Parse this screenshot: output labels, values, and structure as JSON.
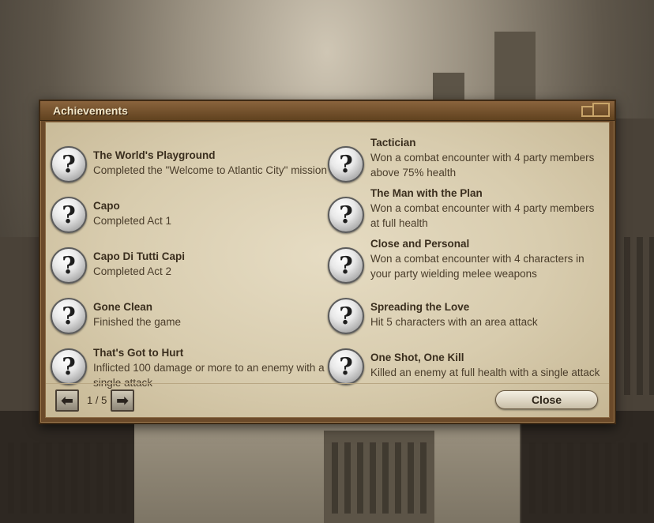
{
  "dialog": {
    "title": "Achievements",
    "achievements": [
      {
        "name": "The World's Playground",
        "desc": "Completed the \"Welcome to Atlantic City\" mission"
      },
      {
        "name": "Capo",
        "desc": "Completed Act 1"
      },
      {
        "name": "Capo Di Tutti Capi",
        "desc": "Completed Act 2"
      },
      {
        "name": "Gone Clean",
        "desc": "Finished the game"
      },
      {
        "name": "That's Got to Hurt",
        "desc": "Inflicted 100 damage or more to an enemy with a single attack"
      },
      {
        "name": "Tactician",
        "desc": "Won a combat encounter with 4 party members above 75% health"
      },
      {
        "name": "The Man with the Plan",
        "desc": "Won a combat encounter with 4 party members at full health"
      },
      {
        "name": "Close and Personal",
        "desc": "Won a combat encounter with 4 characters in your party wielding melee weapons"
      },
      {
        "name": "Spreading the Love",
        "desc": "Hit 5 characters with an area attack"
      },
      {
        "name": "One Shot, One Kill",
        "desc": "Killed an enemy at full health with a single attack"
      }
    ],
    "badge_glyph": "?",
    "pagination": {
      "indicator": "1 / 5",
      "prev_glyph": "⬅",
      "next_glyph": "➡"
    },
    "close_label": "Close"
  }
}
